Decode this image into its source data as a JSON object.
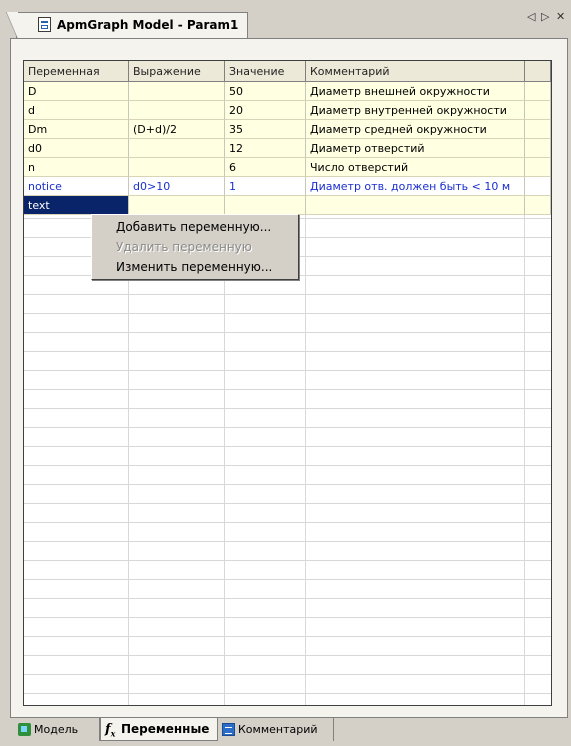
{
  "document_tab": {
    "title": "ApmGraph Model - Param1",
    "icon": "document-icon"
  },
  "window_controls": {
    "prev": "◁",
    "next": "▷",
    "close": "✕"
  },
  "grid": {
    "columns": [
      "Переменная",
      "Выражение",
      "Значение",
      "Комментарий",
      ""
    ],
    "rows": [
      {
        "name": "D",
        "expression": "",
        "value": "50",
        "comment": "Диаметр внешней окружности"
      },
      {
        "name": "d",
        "expression": "",
        "value": "20",
        "comment": "Диаметр внутренней окружности"
      },
      {
        "name": "Dm",
        "expression": "(D+d)/2",
        "value": "35",
        "comment": "Диаметр средней окружности"
      },
      {
        "name": "d0",
        "expression": "",
        "value": "12",
        "comment": "Диаметр отверстий"
      },
      {
        "name": "n",
        "expression": "",
        "value": "6",
        "comment": "Число отверстий"
      },
      {
        "name": "notice",
        "expression": "d0>10",
        "value": "1",
        "comment": "Диаметр отв. должен быть < 10 м"
      },
      {
        "name": "text",
        "expression": "",
        "value": "",
        "comment": ""
      }
    ]
  },
  "context_menu": {
    "items": [
      {
        "label": "Добавить переменную...",
        "enabled": true
      },
      {
        "label": "Удалить переменную",
        "enabled": false
      },
      {
        "label": "Изменить переменную...",
        "enabled": true
      }
    ]
  },
  "bottom_tabs": [
    {
      "label": "Модель",
      "icon": "model-icon",
      "active": false
    },
    {
      "label": "Переменные",
      "icon": "fx-icon",
      "icon_text": "f",
      "icon_sub": "x",
      "active": true
    },
    {
      "label": "Комментарий",
      "icon": "comment-icon",
      "active": false
    }
  ],
  "colors": {
    "selected_row": "#0a246a",
    "yellow_row": "#ffffe1",
    "notice_text": "#1a2fd0",
    "panel_bg": "#f4f3ee"
  }
}
